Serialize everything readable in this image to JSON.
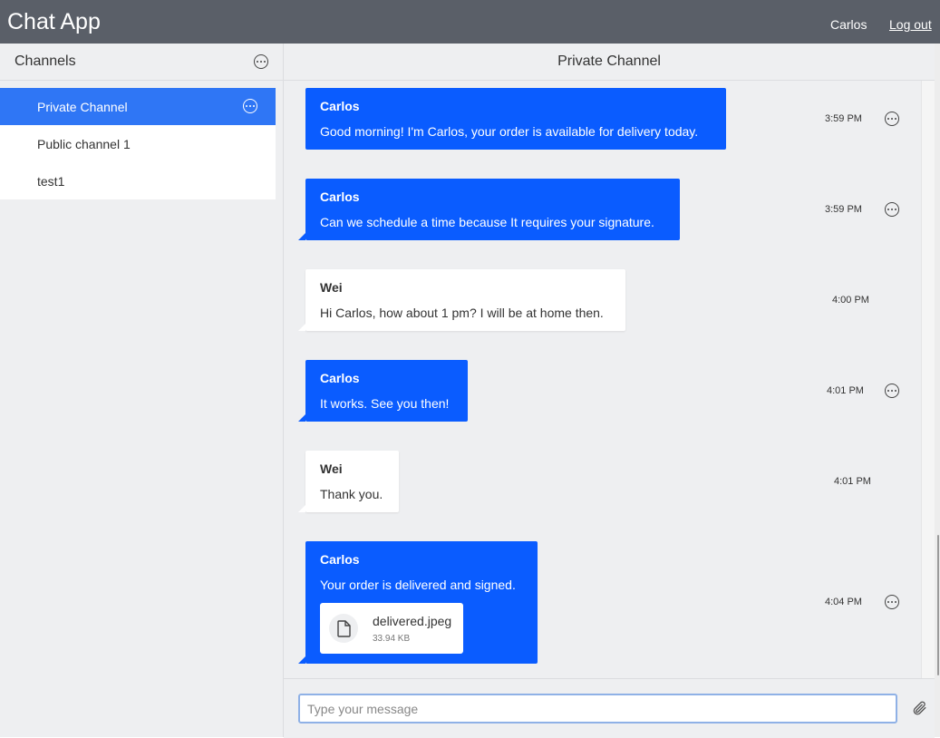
{
  "header": {
    "app_title": "Chat App",
    "user_name": "Carlos",
    "logout_label": "Log out"
  },
  "sidebar": {
    "title": "Channels",
    "channels": [
      {
        "label": "Private Channel",
        "active": true
      },
      {
        "label": "Public channel 1",
        "active": false
      },
      {
        "label": "test1",
        "active": false
      }
    ]
  },
  "chat": {
    "title": "Private Channel",
    "messages": [
      {
        "sender": "Carlos",
        "text": "Good morning! I'm Carlos, your order is available for delivery today.",
        "time": "3:59 PM",
        "mine": true
      },
      {
        "sender": "Carlos",
        "text": "Can we schedule a time because It requires your signature.",
        "time": "3:59 PM",
        "mine": true
      },
      {
        "sender": "Wei",
        "text": "Hi Carlos, how about 1 pm? I will be at home then.",
        "time": "4:00 PM",
        "mine": false
      },
      {
        "sender": "Carlos",
        "text": "It works. See you then!",
        "time": "4:01 PM",
        "mine": true
      },
      {
        "sender": "Wei",
        "text": "Thank you.",
        "time": "4:01 PM",
        "mine": false
      },
      {
        "sender": "Carlos",
        "text": "Your order is delivered and signed.",
        "time": "4:04 PM",
        "mine": true,
        "attachment": {
          "name": "delivered.jpeg",
          "size": "33.94 KB",
          "icon": "file-icon"
        }
      }
    ]
  },
  "composer": {
    "placeholder": "Type your message",
    "value": "",
    "attach_icon": "paperclip-icon"
  },
  "colors": {
    "topbar": "#5a5f68",
    "accent": "#0a5cff",
    "active_channel": "#2f76f5",
    "panel_bg": "#eeeff1"
  }
}
